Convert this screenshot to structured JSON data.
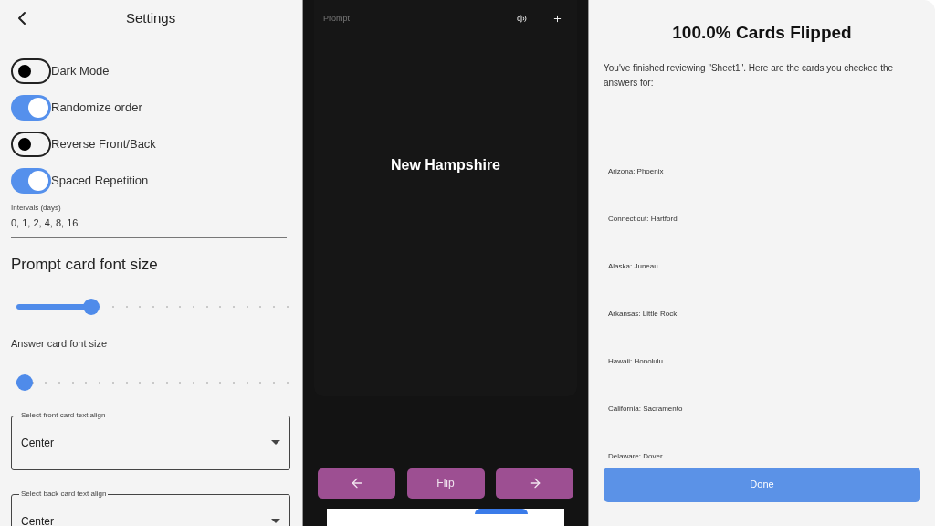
{
  "settings": {
    "title": "Settings",
    "toggles": [
      {
        "label": "Dark Mode",
        "on": false
      },
      {
        "label": "Randomize order",
        "on": true
      },
      {
        "label": "Reverse Front/Back",
        "on": false
      },
      {
        "label": "Spaced Repetition",
        "on": true
      }
    ],
    "intervals": {
      "label": "Intervals (days)",
      "value": "0, 1, 2, 4, 8, 16"
    },
    "prompt_font": {
      "label": "Prompt card font size",
      "level": 0.25
    },
    "answer_font": {
      "label": "Answer card font size",
      "level": 0
    },
    "selects": [
      {
        "label": "Select front card text align",
        "value": "Center"
      },
      {
        "label": "Select back card text align",
        "value": "Center"
      }
    ]
  },
  "card": {
    "label": "Prompt",
    "text": "New Hampshire",
    "buttons": [
      {
        "kind": "prev"
      },
      {
        "kind": "flip",
        "label": "Flip"
      },
      {
        "kind": "next"
      }
    ]
  },
  "summary": {
    "title": "100.0% Cards Flipped",
    "message": "You've finished reviewing \"Sheet1\". Here are the cards you checked the answers for:",
    "cards": [
      "Arizona: Phoenix",
      "Connecticut: Hartford",
      "Alaska: Juneau",
      "Arkansas: Little Rock",
      "Hawaii: Honolulu",
      "California: Sacramento",
      "Delaware: Dover"
    ],
    "button": "Done"
  }
}
